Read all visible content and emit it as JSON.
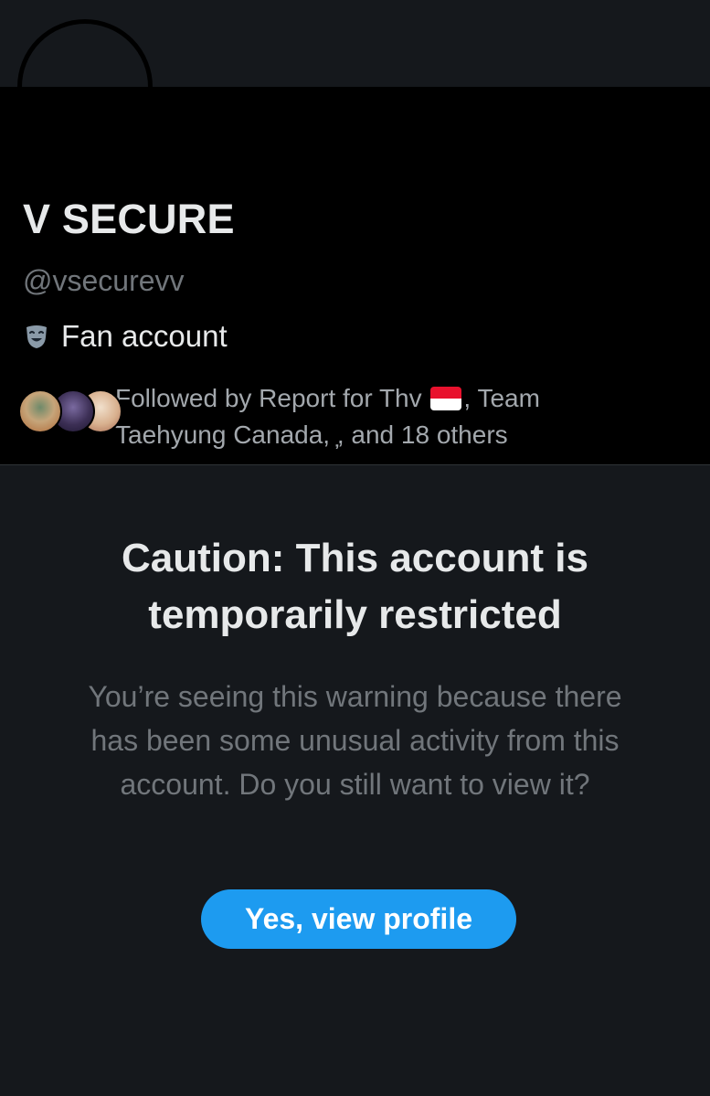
{
  "profile": {
    "display_name": "V SECURE",
    "handle": "@vsecurevv",
    "bio_icon": "theater-mask-icon",
    "bio": "Fan account",
    "followed_by": {
      "prefix": "Followed by Report for Thv",
      "flag": "indonesia-flag-icon",
      "suffix_line1": ", Team",
      "line2": "Taehyung Canada, ̦, and 18 others"
    }
  },
  "warning": {
    "title": "Caution: This account is temporarily restricted",
    "body": "You’re seeing this warning because there has been some unusual activity from this account. Do you still want to view it?",
    "button_label": "Yes, view profile"
  },
  "colors": {
    "background": "#15181c",
    "profile_panel": "#000000",
    "accent": "#1d9bf0",
    "muted_text": "#71767b"
  }
}
